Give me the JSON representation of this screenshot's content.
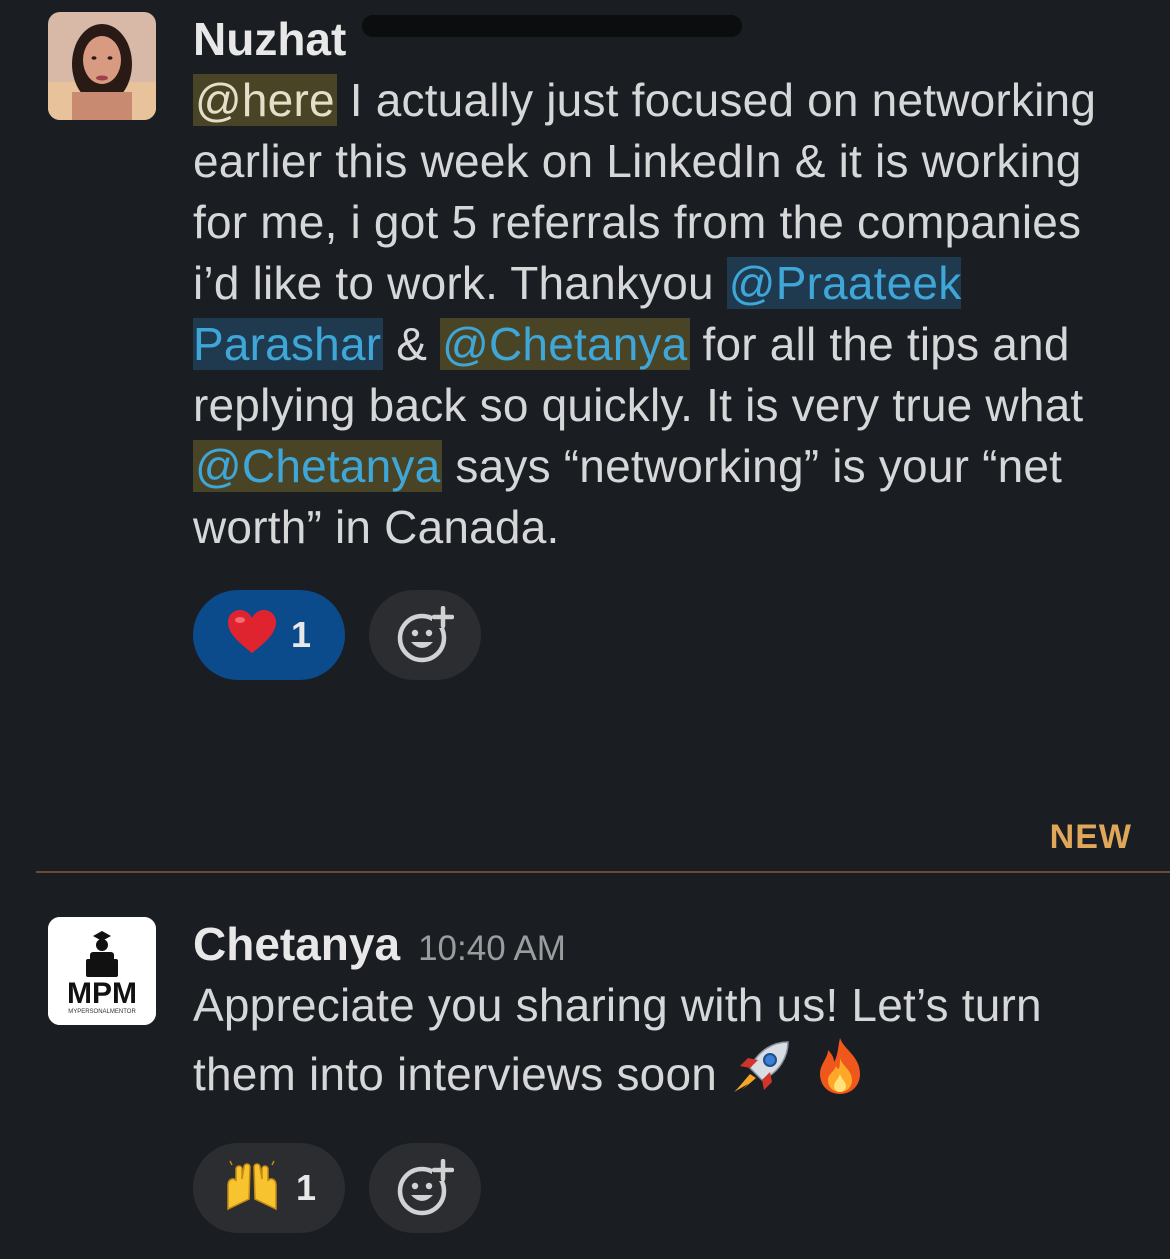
{
  "messages": [
    {
      "author": "Nuzhat",
      "avatar_icon": "user-photo-avatar",
      "text": {
        "p1_mention": "@here",
        "p1": " I actually just focused on networking earlier this week on LinkedIn & it is working for me, i got 5 referrals from the companies i’d like to work. Thankyou ",
        "p2_mention": "@Praateek Parashar",
        "p2": " & ",
        "p3_mention": "@Chetanya",
        "p3": " for all the tips and replying back so quickly. It is very true what ",
        "p4_mention": "@Chetanya",
        "p4": " says “networking” is your “net worth” in Canada."
      },
      "reactions": [
        {
          "emoji": "❤️",
          "emoji_name": "heart-emoji",
          "count": "1",
          "active": true
        }
      ],
      "add_reaction_icon": "add-reaction-icon"
    },
    {
      "author": "Chetanya",
      "timestamp": "10:40 AM",
      "avatar_logo_text": "MPM",
      "avatar_logo_subtext": "MYPERSONALMENTOR",
      "text": {
        "p1": "Appreciate you sharing with us! Let’s turn them into interviews soon ",
        "emoji1": "🚀",
        "emoji2": "🔥"
      },
      "reactions": [
        {
          "emoji": "🙌",
          "emoji_name": "raised-hands-emoji",
          "count": "1",
          "active": false
        }
      ],
      "add_reaction_icon": "add-reaction-icon"
    }
  ],
  "divider": {
    "label": "NEW",
    "color": "#e0a75a"
  },
  "colors": {
    "background": "#1a1d21",
    "mention_bg": "#4a4427",
    "user_mention_text": "#3fa6d8",
    "active_reaction_bg": "#0b4a8b"
  }
}
